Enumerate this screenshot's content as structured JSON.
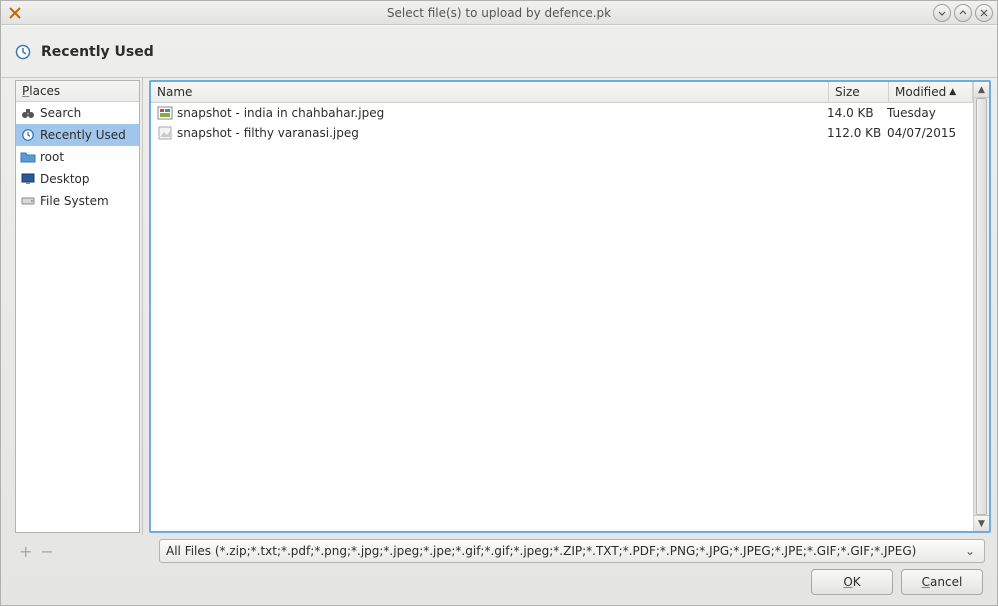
{
  "titlebar": {
    "title": "Select file(s) to upload by defence.pk"
  },
  "heading": "Recently Used",
  "places": {
    "header_html": "<span class='u'>P</span>laces",
    "items": [
      {
        "label": "Search",
        "icon": "binoculars"
      },
      {
        "label": "Recently Used",
        "icon": "clock",
        "selected": true
      },
      {
        "label": "root",
        "icon": "folder"
      },
      {
        "label": "Desktop",
        "icon": "desktop"
      },
      {
        "label": "File System",
        "icon": "drive"
      }
    ]
  },
  "columns": {
    "name": "Name",
    "size": "Size",
    "modified": "Modified"
  },
  "files": [
    {
      "name": "snapshot - india in chahbahar.jpeg",
      "size": "14.0 KB",
      "modified": "Tuesday",
      "icon": "image"
    },
    {
      "name": "snapshot - filthy varanasi.jpeg",
      "size": "112.0 KB",
      "modified": "04/07/2015",
      "icon": "image-generic"
    }
  ],
  "filter": {
    "text": "All Files (*.zip;*.txt;*.pdf;*.png;*.jpg;*.jpeg;*.jpe;*.gif;*.gif;*.jpeg;*.ZIP;*.TXT;*.PDF;*.PNG;*.JPG;*.JPEG;*.JPE;*.GIF;*.GIF;*.JPEG)"
  },
  "buttons": {
    "ok_html": "<span class='u'>O</span>K",
    "cancel_html": "<span class='u'>C</span>ancel"
  }
}
